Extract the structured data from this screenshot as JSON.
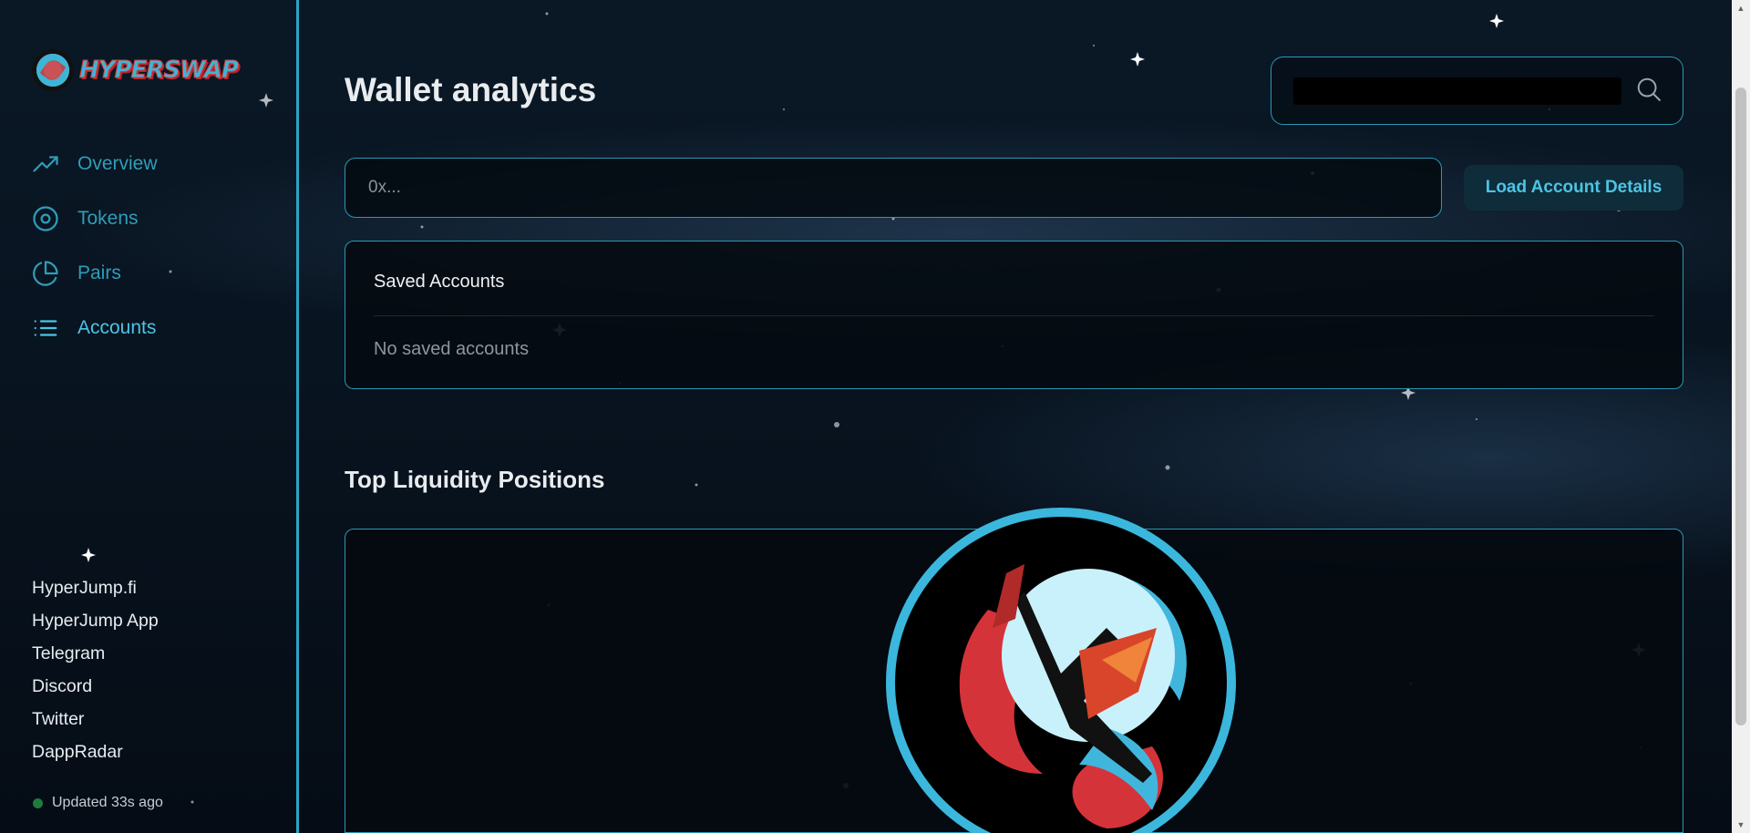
{
  "brand": {
    "name": "HYPERSWAP",
    "logo_icon": "hyperswap-logo-icon"
  },
  "nav": {
    "items": [
      {
        "label": "Overview",
        "icon": "trending-up-icon",
        "active": false
      },
      {
        "label": "Tokens",
        "icon": "target-icon",
        "active": false
      },
      {
        "label": "Pairs",
        "icon": "pie-chart-icon",
        "active": false
      },
      {
        "label": "Accounts",
        "icon": "list-icon",
        "active": true
      }
    ]
  },
  "links": [
    "HyperJump.fi",
    "HyperJump App",
    "Telegram",
    "Discord",
    "Twitter",
    "DappRadar"
  ],
  "status": {
    "text": "Updated 33s ago",
    "color": "#1f7c3e"
  },
  "page": {
    "title": "Wallet analytics"
  },
  "search": {
    "icon": "search-icon"
  },
  "account_input": {
    "placeholder": "0x...",
    "value": ""
  },
  "load_button": {
    "label": "Load Account Details"
  },
  "saved_accounts": {
    "title": "Saved Accounts",
    "empty_text": "No saved accounts"
  },
  "top_liquidity": {
    "title": "Top Liquidity Positions",
    "loader_icon": "hyperswap-loading-logo-icon"
  },
  "colors": {
    "accent": "#2aa6c4",
    "nav_active": "#4cc4e3",
    "background": "#07121e",
    "button_bg": "#0f2c3b"
  }
}
